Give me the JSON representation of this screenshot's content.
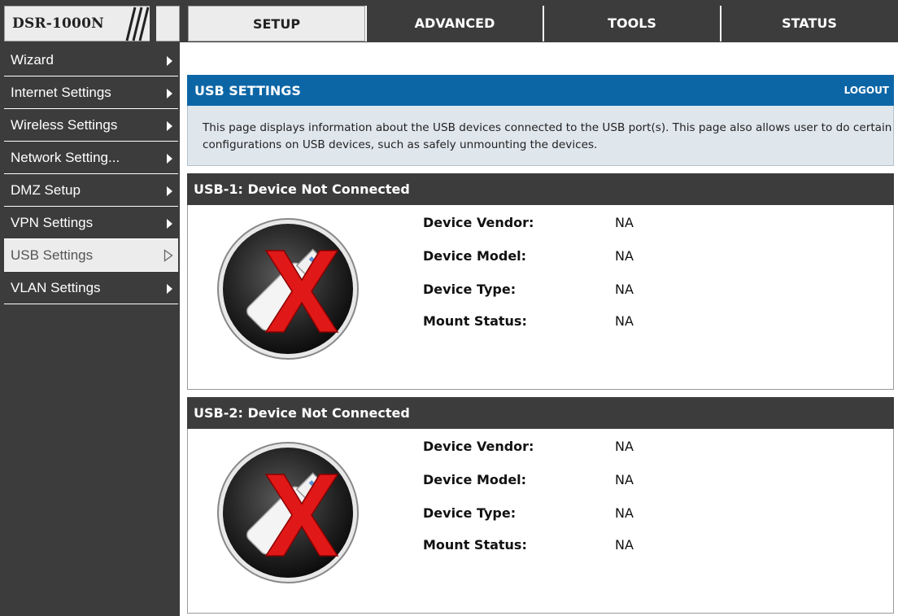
{
  "brand": {
    "model": "DSR-1000N"
  },
  "tabs": [
    {
      "label": "SETUP",
      "active": true
    },
    {
      "label": "ADVANCED",
      "active": false
    },
    {
      "label": "TOOLS",
      "active": false
    },
    {
      "label": "STATUS",
      "active": false
    }
  ],
  "sidebar": {
    "items": [
      {
        "label": "Wizard",
        "active": false
      },
      {
        "label": "Internet Settings",
        "active": false
      },
      {
        "label": "Wireless Settings",
        "active": false
      },
      {
        "label": "Network Setting...",
        "active": false
      },
      {
        "label": "DMZ Setup",
        "active": false
      },
      {
        "label": "VPN Settings",
        "active": false
      },
      {
        "label": "USB Settings",
        "active": true
      },
      {
        "label": "VLAN Settings",
        "active": false
      }
    ]
  },
  "page": {
    "title": "USB SETTINGS",
    "logout_label": "LOGOUT",
    "description": "This page displays information about the USB devices connected to the USB port(s). This page also allows user to do certain configurations on USB devices, such as safely unmounting the devices."
  },
  "usb_panels": [
    {
      "title": "USB-1: Device Not Connected",
      "icon": "usb-disconnected-icon",
      "fields": [
        {
          "label": "Device Vendor:",
          "value": "NA"
        },
        {
          "label": "Device Model:",
          "value": "NA"
        },
        {
          "label": "Device Type:",
          "value": "NA"
        },
        {
          "label": "Mount Status:",
          "value": "NA"
        }
      ]
    },
    {
      "title": "USB-2: Device Not Connected",
      "icon": "usb-disconnected-icon",
      "fields": [
        {
          "label": "Device Vendor:",
          "value": "NA"
        },
        {
          "label": "Device Model:",
          "value": "NA"
        },
        {
          "label": "Device Type:",
          "value": "NA"
        },
        {
          "label": "Mount Status:",
          "value": "NA"
        }
      ]
    }
  ],
  "colors": {
    "header_blue": "#0c66a6",
    "dark_gray": "#3c3c3c",
    "light_gray": "#ececec",
    "desc_bg": "#dfe6ec",
    "x_red": "#e01818"
  }
}
